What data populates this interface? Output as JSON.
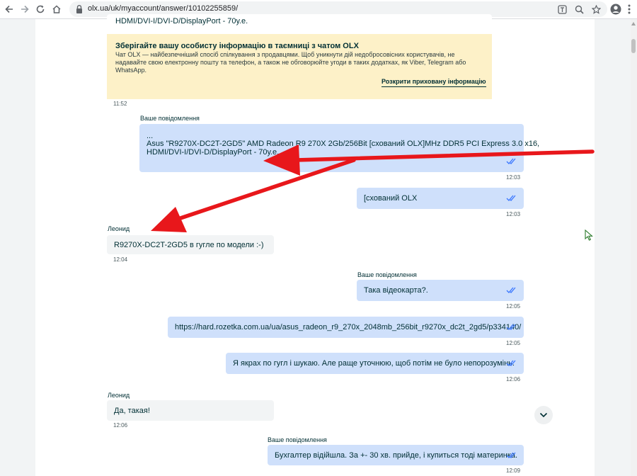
{
  "browser": {
    "url": "olx.ua/uk/myaccount/answer/10102255859/",
    "icons": [
      "back-icon",
      "forward-icon",
      "reload-icon",
      "home-icon",
      "lock-icon",
      "translate-icon",
      "zoom-icon",
      "star-icon",
      "profile-icon",
      "menu-icon"
    ]
  },
  "chat": {
    "top_fragment": "HDMI/DVI-I/DVI-D/DisplayPort - 70у.е.",
    "warning": {
      "title": "Зберігайте вашу особисту інформацію в таємниці з чатом OLX",
      "body": "Чат OLX — найбезпечніший спосіб спілкування з продавцями. Щоб уникнути дій недобросовісних користувачів, не надавайте свою електронну пошту та телефон, а також не обговорюйте угоди в таких додатках, як Viber, Telegram або WhatsApp.",
      "link": "Розкрити приховану інформацію"
    },
    "warning_time": "11:52",
    "my_label": "Ваше повідомлення",
    "other_name": "Леонид",
    "messages": [
      {
        "line1": "...",
        "line2": "Asus \"R9270X-DC2T-2GD5\" AMD Radeon R9 270X 2Gb/256Bit [схований OLX]MHz DDR5 PCI Express 3.0 x16,",
        "line3": "HDMI/DVI-I/DVI-D/DisplayPort - 70у.е.",
        "time": "12:03"
      },
      {
        "text": "[схований OLX",
        "time": "12:03"
      },
      {
        "text": "R9270X-DC2T-2GD5 в гугле по модели :-)",
        "time": "12:04"
      },
      {
        "text": "Така відеокарта?.",
        "time": "12:05"
      },
      {
        "text": "https://hard.rozetka.com.ua/ua/asus_radeon_r9_270x_2048mb_256bit_r9270x_dc2t_2gd5/p334140/",
        "time": "12:05"
      },
      {
        "text": "Я якрах по гугл і шукаю. Але раще уточнюю, щоб потім не було непорозумінь.",
        "time": "12:06"
      },
      {
        "text": "Да, такая!",
        "time": "12:06"
      },
      {
        "text": "Бухгалтер відійшла. За +- 30 хв. прийде, і купиться тоді материнка.",
        "time": "12:09"
      }
    ]
  },
  "colors": {
    "my_bubble": "#cfe0fb",
    "their_bubble": "#f2f4f5",
    "warning_bg": "#fdf1c8",
    "annotation_arrow": "#e8171b",
    "read_check": "#3a77ff"
  }
}
